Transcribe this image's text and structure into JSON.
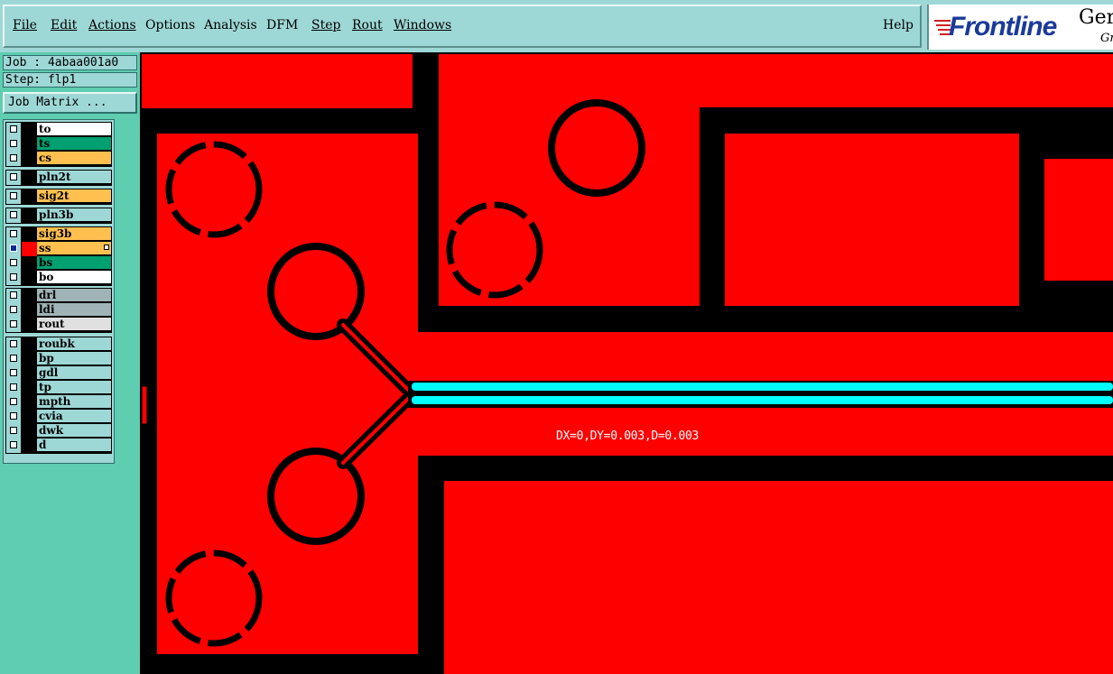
{
  "menubar": {
    "items": [
      {
        "label": "File",
        "underline": true
      },
      {
        "label": "Edit",
        "underline": true
      },
      {
        "label": "Actions",
        "underline": true
      },
      {
        "label": "Options",
        "underline": false
      },
      {
        "label": "Analysis",
        "underline": false
      },
      {
        "label": "DFM",
        "underline": false
      },
      {
        "label": "Step",
        "underline": true
      },
      {
        "label": "Rout",
        "underline": true
      },
      {
        "label": "Windows",
        "underline": true
      }
    ],
    "help_label": "Help"
  },
  "logo": {
    "brand": "Frontline",
    "ger": "Ger",
    "gr": "Gr"
  },
  "sidebar": {
    "job_label": "Job : 4abaa001a0",
    "step_label": "Step: flp1",
    "job_matrix_label": "Job Matrix ..."
  },
  "layers": [
    {
      "name": "to",
      "color": "#ffffff",
      "checked": false,
      "swatch": "#000000",
      "group": 0
    },
    {
      "name": "ts",
      "color": "#00a070",
      "checked": false,
      "swatch": "#000000",
      "group": 0
    },
    {
      "name": "cs",
      "color": "#ffc050",
      "checked": false,
      "swatch": "#000000",
      "group": 0
    },
    {
      "name": "pln2t",
      "color": "#9ed8d6",
      "checked": false,
      "swatch": "#000000",
      "group": 1
    },
    {
      "name": "sig2t",
      "color": "#ffc050",
      "checked": false,
      "swatch": "#000000",
      "group": 2
    },
    {
      "name": "pln3b",
      "color": "#9ed8d6",
      "checked": false,
      "swatch": "#000000",
      "group": 3
    },
    {
      "name": "sig3b",
      "color": "#ffc050",
      "checked": false,
      "swatch": "#000000",
      "group": 4
    },
    {
      "name": "ss",
      "color": "#ffc050",
      "checked": true,
      "swatch": "#ff0000",
      "group": 4,
      "marked": true
    },
    {
      "name": "bs",
      "color": "#00a070",
      "checked": false,
      "swatch": "#000000",
      "group": 4
    },
    {
      "name": "bo",
      "color": "#ffffff",
      "checked": false,
      "swatch": "#000000",
      "group": 4
    },
    {
      "name": "drl",
      "color": "#a0b4b8",
      "checked": false,
      "swatch": "#000000",
      "group": 5
    },
    {
      "name": "ldi",
      "color": "#a0b4b8",
      "checked": false,
      "swatch": "#000000",
      "group": 5
    },
    {
      "name": "rout",
      "color": "#e0e0e0",
      "checked": false,
      "swatch": "#000000",
      "group": 5
    },
    {
      "name": "roubk",
      "color": "#9ed8d6",
      "checked": false,
      "swatch": "#000000",
      "group": 6
    },
    {
      "name": "bp",
      "color": "#9ed8d6",
      "checked": false,
      "swatch": "#000000",
      "group": 6
    },
    {
      "name": "gdl",
      "color": "#9ed8d6",
      "checked": false,
      "swatch": "#000000",
      "group": 6
    },
    {
      "name": "tp",
      "color": "#9ed8d6",
      "checked": false,
      "swatch": "#000000",
      "group": 6
    },
    {
      "name": "mpth",
      "color": "#9ed8d6",
      "checked": false,
      "swatch": "#000000",
      "group": 6
    },
    {
      "name": "cvia",
      "color": "#9ed8d6",
      "checked": false,
      "swatch": "#000000",
      "group": 6
    },
    {
      "name": "dwk",
      "color": "#9ed8d6",
      "checked": false,
      "swatch": "#000000",
      "group": 6
    },
    {
      "name": "d",
      "color": "#9ed8d6",
      "checked": false,
      "swatch": "#000000",
      "group": 6
    }
  ],
  "canvas": {
    "measure_text": "DX=0,DY=0.003,D=0.003",
    "copper_color": "#ff0000",
    "highlight_color": "#00ffff"
  }
}
